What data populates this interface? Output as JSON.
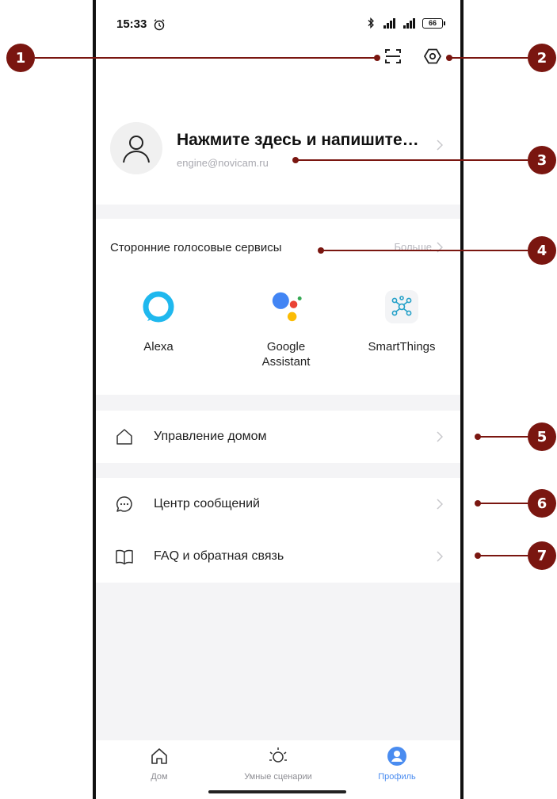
{
  "status_bar": {
    "time": "15:33",
    "battery": "66"
  },
  "profile": {
    "name": "Нажмите здесь и напишите…",
    "email": "engine@novicam.ru"
  },
  "voice_services": {
    "title": "Сторонние голосовые сервисы",
    "more_label": "Больше",
    "items": [
      {
        "label": "Alexa",
        "icon": "alexa-icon"
      },
      {
        "label": "Google Assistant",
        "icon": "google-assistant-icon"
      },
      {
        "label": "SmartThings",
        "icon": "smartthings-icon"
      }
    ]
  },
  "menu": {
    "home_management": "Управление домом",
    "message_center": "Центр сообщений",
    "faq_feedback": "FAQ и обратная связь"
  },
  "tabs": [
    {
      "label": "Дом",
      "icon": "home-icon",
      "active": false
    },
    {
      "label": "Умные сценарии",
      "icon": "smart-scene-icon",
      "active": false
    },
    {
      "label": "Профиль",
      "icon": "profile-icon",
      "active": true
    }
  ],
  "callouts": [
    "1",
    "2",
    "3",
    "4",
    "5",
    "6",
    "7"
  ],
  "colors": {
    "accent": "#4a8cf0",
    "callout": "#7a1610",
    "background": "#f4f4f6"
  }
}
